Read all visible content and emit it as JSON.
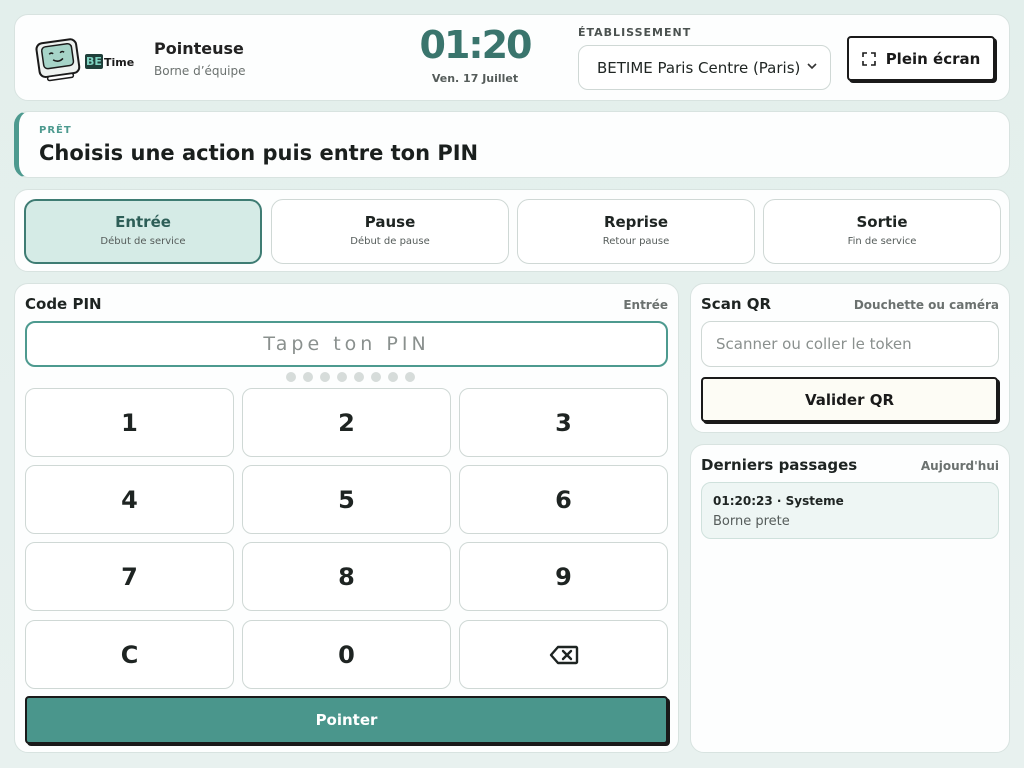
{
  "header": {
    "logo_text_be": "BE",
    "logo_text_time": "Time",
    "app_title": "Pointeuse",
    "app_subtitle": "Borne d’équipe",
    "clock": "01:20",
    "date": "Ven. 17 Juillet",
    "establishment_label": "ÉTABLISSEMENT",
    "establishment_value": "BETIME Paris Centre (Paris)",
    "fullscreen_label": "Plein écran"
  },
  "status": {
    "kicker": "PRÊT",
    "message": "Choisis une action puis entre ton PIN"
  },
  "actions": [
    {
      "title": "Entrée",
      "subtitle": "Début de service",
      "active": true
    },
    {
      "title": "Pause",
      "subtitle": "Début de pause",
      "active": false
    },
    {
      "title": "Reprise",
      "subtitle": "Retour pause",
      "active": false
    },
    {
      "title": "Sortie",
      "subtitle": "Fin de service",
      "active": false
    }
  ],
  "pin": {
    "title": "Code PIN",
    "mode": "Entrée",
    "placeholder": "Tape ton PIN",
    "value": "",
    "dot_count": 8,
    "keys": [
      "1",
      "2",
      "3",
      "4",
      "5",
      "6",
      "7",
      "8",
      "9",
      "C",
      "0",
      "backspace"
    ],
    "submit_label": "Pointer"
  },
  "qr": {
    "title": "Scan QR",
    "hint": "Douchette ou caméra",
    "placeholder": "Scanner ou coller le token",
    "validate_label": "Valider QR"
  },
  "recent": {
    "title": "Derniers passages",
    "when": "Aujourd'hui",
    "items": [
      {
        "head": "01:20:23 · Systeme",
        "text": "Borne prete"
      }
    ]
  },
  "colors": {
    "accent": "#4a968c",
    "accent_dark": "#3a756d",
    "active_bg": "#d5ebe6",
    "background": "#e3efec"
  },
  "icons": {
    "logo": "terminal-mascot-icon",
    "fullscreen": "fullscreen-icon",
    "select": "chevron-down-icon",
    "backspace": "backspace-icon"
  }
}
